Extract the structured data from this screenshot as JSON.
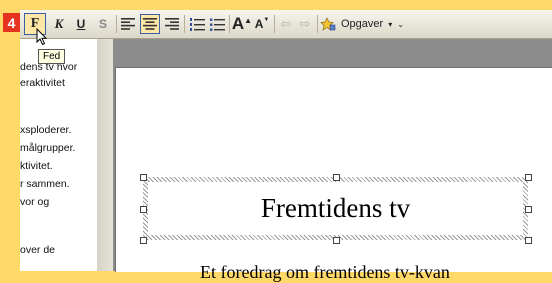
{
  "step": "4",
  "toolbar": {
    "bold": "F",
    "italic": "K",
    "underline": "U",
    "shadow": "S",
    "grow_font": "A",
    "shrink_font": "A",
    "tasks_label": "Opgaver",
    "tasks_dropdown": "▾",
    "overflow": "⌄"
  },
  "tooltip": "Fed",
  "outline": [
    "dens tv hvor",
    "eraktivitet",
    "",
    "",
    "xsploderer.",
    "målgrupper.",
    "ktivitet.",
    "r sammen.",
    "vor og",
    "",
    "",
    "over de"
  ],
  "slide": {
    "title": "Fremtidens tv",
    "subtitle": "Et foredrag om fremtidens tv-kvan"
  },
  "colors": {
    "badge": "#e6331f",
    "page_bg": "#ffd86a",
    "highlight": "#ffe7a6"
  }
}
